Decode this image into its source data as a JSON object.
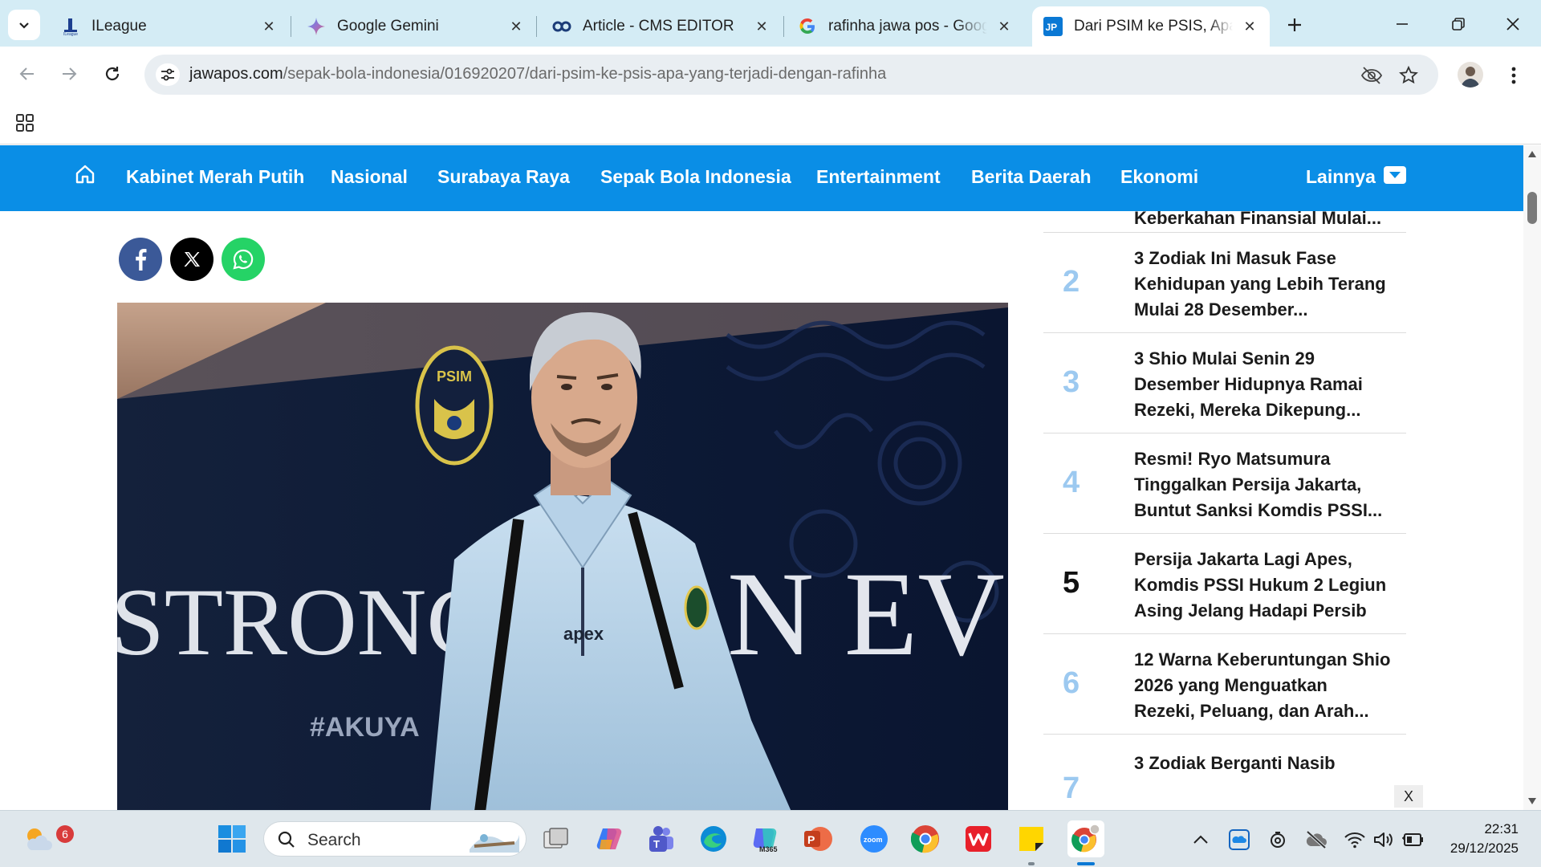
{
  "browser": {
    "tabs": [
      {
        "title": "ILeague",
        "favicon": "ileague-icon"
      },
      {
        "title": "Google Gemini",
        "favicon": "gemini-icon"
      },
      {
        "title": "Article - CMS EDITOR",
        "favicon": "cms-icon"
      },
      {
        "title": "rafinha jawa pos - Google",
        "favicon": "google-icon"
      },
      {
        "title": "Dari PSIM ke PSIS, Apa yang",
        "favicon": "jawapos-icon",
        "active": true
      }
    ],
    "url_domain": "jawapos.com",
    "url_path": "/sepak-bola-indonesia/016920207/dari-psim-ke-psis-apa-yang-terjadi-dengan-rafinha"
  },
  "site": {
    "nav_items": [
      "Kabinet Merah Putih",
      "Nasional",
      "Surabaya Raya",
      "Sepak Bola Indonesia",
      "Entertainment",
      "Berita Daerah",
      "Ekonomi"
    ],
    "more_label": "Lainnya",
    "brand_color": "#0a8ee6"
  },
  "article": {
    "share": [
      "facebook",
      "x",
      "whatsapp"
    ],
    "image_texts": {
      "backdrop": "STRONGER",
      "backdrop_right": "N EVI",
      "hashtag": "#AKUYA",
      "logo": "PSIM",
      "shirt_brand": "apex"
    }
  },
  "trending": {
    "items": [
      {
        "num": "",
        "title": "Semesta untuk Menerima Keberkahan Finansial Mulai..."
      },
      {
        "num": "2",
        "title": "3 Zodiak Ini Masuk Fase Kehidupan yang Lebih Terang Mulai 28 Desember..."
      },
      {
        "num": "3",
        "title": "3 Shio Mulai Senin 29 Desember Hidupnya Ramai Rezeki, Mereka Dikepung..."
      },
      {
        "num": "4",
        "title": "Resmi! Ryo Matsumura Tinggalkan Persija Jakarta, Buntut Sanksi Komdis PSSI..."
      },
      {
        "num": "5",
        "title": "Persija Jakarta Lagi Apes, Komdis PSSI Hukum 2 Legiun Asing Jelang Hadapi Persib"
      },
      {
        "num": "6",
        "title": "12 Warna Keberuntungan Shio 2026 yang Menguatkan Rezeki, Peluang, dan Arah..."
      },
      {
        "num": "7",
        "title": "3 Zodiak Berganti Nasib"
      }
    ],
    "ad_close_label": "X"
  },
  "taskbar": {
    "weather_badge": "6",
    "search_label": "Search",
    "time": "22:31",
    "date": "29/12/2025"
  }
}
